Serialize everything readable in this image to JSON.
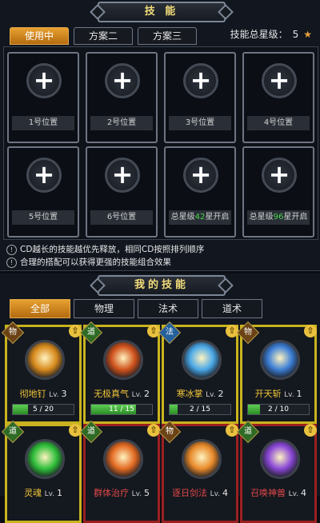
{
  "skills_panel": {
    "title": "技 能",
    "tabs": [
      {
        "label": "使用中",
        "active": true
      },
      {
        "label": "方案二",
        "active": false
      },
      {
        "label": "方案三",
        "active": false
      }
    ],
    "star_total_label": "技能总星级：",
    "star_total_value": "5",
    "slots": [
      {
        "label": "1号位置"
      },
      {
        "label": "2号位置"
      },
      {
        "label": "3号位置"
      },
      {
        "label": "4号位置"
      },
      {
        "label": "5号位置"
      },
      {
        "label": "6号位置"
      },
      {
        "prefix": "总星级",
        "count": "42",
        "suffix": "星开启"
      },
      {
        "prefix": "总星级",
        "count": "96",
        "suffix": "星开启"
      }
    ],
    "tips": [
      "CD越长的技能越优先释放，相同CD按照排列顺序",
      "合理的搭配可以获得更强的技能组合效果"
    ]
  },
  "my_skills": {
    "title": "我的技能",
    "tabs": [
      {
        "label": "全部",
        "active": true
      },
      {
        "label": "物理",
        "active": false
      },
      {
        "label": "法术",
        "active": false
      },
      {
        "label": "道术",
        "active": false
      }
    ],
    "cards": [
      {
        "type": "物",
        "name": "彻地钉",
        "level": "3",
        "progress": "5 / 20",
        "fraction": 0.25,
        "border": "gold",
        "icon_color": "#d88a1c"
      },
      {
        "type": "道",
        "name": "无极真气",
        "level": "2",
        "progress": "11 / 15",
        "fraction": 0.733,
        "border": "gold",
        "icon_color": "#d0521c"
      },
      {
        "type": "法",
        "name": "寒冰掌",
        "level": "2",
        "progress": "2 / 15",
        "fraction": 0.133,
        "border": "gold",
        "icon_color": "#4aa8e8"
      },
      {
        "type": "物",
        "name": "开天斩",
        "level": "1",
        "progress": "2 / 10",
        "fraction": 0.2,
        "border": "gold",
        "icon_color": "#3d7fd6"
      },
      {
        "type": "道",
        "name": "灵魂",
        "level": "1",
        "border": "gold",
        "icon_color": "#2fbf3a"
      },
      {
        "type": "道",
        "name": "群体治疗",
        "level": "5",
        "border": "red",
        "icon_color": "#e36a22"
      },
      {
        "type": "物",
        "name": "逐日剑法",
        "level": "4",
        "border": "red",
        "icon_color": "#e88a2a"
      },
      {
        "type": "道",
        "name": "召唤神兽",
        "level": "4",
        "border": "red",
        "icon_color": "#8a48d6"
      }
    ],
    "lv_label": "Lv."
  }
}
